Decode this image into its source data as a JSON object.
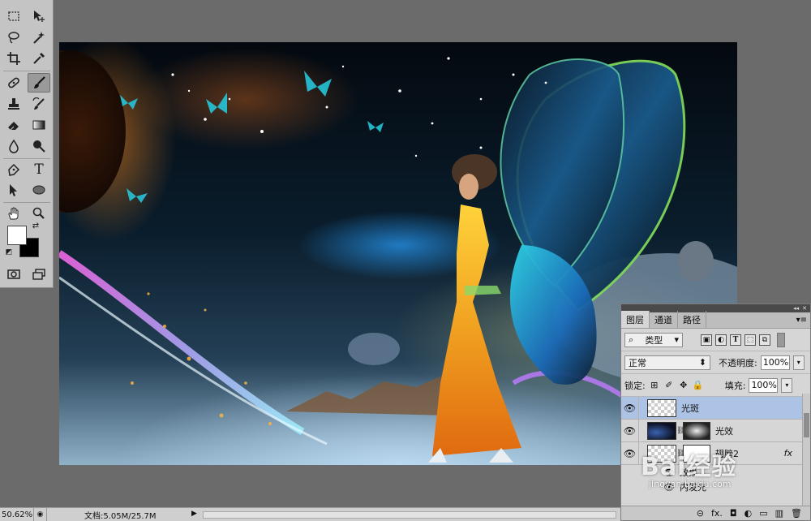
{
  "tools": [
    {
      "name": "rect-marquee-tool",
      "glyph": "⬚"
    },
    {
      "name": "move-tool",
      "glyph": "✥"
    },
    {
      "name": "lasso-tool",
      "glyph": "ᘓ"
    },
    {
      "name": "magic-wand-tool",
      "glyph": "✸"
    },
    {
      "name": "crop-tool",
      "glyph": "⌗"
    },
    {
      "name": "eyedropper-tool",
      "glyph": "✎"
    },
    {
      "name": "healing-brush-tool",
      "glyph": "✚"
    },
    {
      "name": "brush-tool",
      "glyph": "✐",
      "active": true
    },
    {
      "name": "clone-stamp-tool",
      "glyph": "♟"
    },
    {
      "name": "history-brush-tool",
      "glyph": "↺"
    },
    {
      "name": "eraser-tool",
      "glyph": "▱"
    },
    {
      "name": "gradient-tool",
      "glyph": "▤"
    },
    {
      "name": "blur-tool",
      "glyph": "💧"
    },
    {
      "name": "dodge-tool",
      "glyph": "●"
    },
    {
      "name": "pen-tool",
      "glyph": "✒"
    },
    {
      "name": "type-tool",
      "glyph": "T"
    },
    {
      "name": "path-select-tool",
      "glyph": "➤"
    },
    {
      "name": "ellipse-tool",
      "glyph": "⬭"
    },
    {
      "name": "hand-tool",
      "glyph": "✋"
    },
    {
      "name": "zoom-tool",
      "glyph": "🔍"
    },
    {
      "name": "quick-mask-tool",
      "glyph": "◙"
    },
    {
      "name": "screen-mode-tool",
      "glyph": "▣"
    }
  ],
  "colors": {
    "foreground": "#ffffff",
    "background": "#000000",
    "selected_layer": "#adc3e6"
  },
  "panel": {
    "tabs": [
      "图层",
      "通道",
      "路径"
    ],
    "filter_label": "类型",
    "blend_mode": "正常",
    "opacity_label": "不透明度:",
    "opacity_value": "100%",
    "lock_label": "锁定:",
    "fill_label": "填充:",
    "fill_value": "100%",
    "layers": [
      {
        "name": "光斑",
        "selected": true
      },
      {
        "name": "光效",
        "selected": false
      },
      {
        "name": "翅膀2",
        "selected": false,
        "fx": "fx"
      }
    ],
    "effects_label": "效果",
    "inner_glow_label": "内发光",
    "footer_icons": [
      "⊝",
      "fx.",
      "◘",
      "◐",
      "▭",
      "▥",
      "🗑"
    ]
  },
  "status": {
    "zoom": "50.62%",
    "doc_info": "文档:5.05M/25.7M"
  },
  "watermark": {
    "text": "Bai经验",
    "url": "jingyan.baidu.com"
  }
}
